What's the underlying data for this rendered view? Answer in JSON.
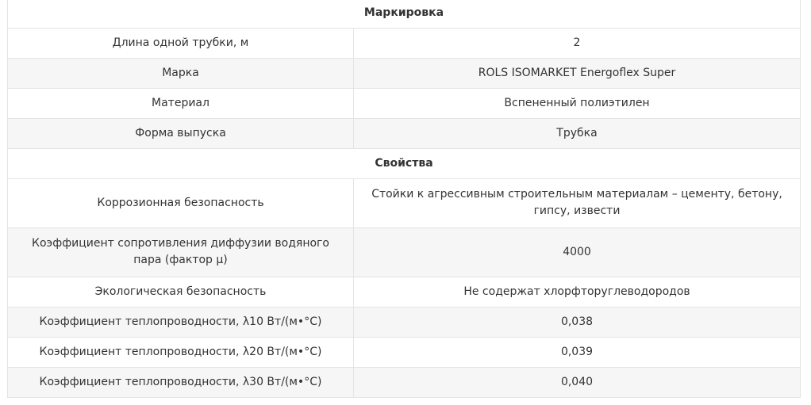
{
  "sections": [
    {
      "title": "Маркировка",
      "rows": [
        {
          "label": "Длина одной трубки, м",
          "value": "2"
        },
        {
          "label": "Марка",
          "value": "ROLS ISOMARKET Energoflex Super"
        },
        {
          "label": "Материал",
          "value": "Вспененный полиэтилен"
        },
        {
          "label": "Форма выпуска",
          "value": "Трубка"
        }
      ]
    },
    {
      "title": "Свойства",
      "rows": [
        {
          "label": "Коррозионная безопасность",
          "value": "Стойки к агрессивным строительным материалам – цементу, бетону, гипсу, извести"
        },
        {
          "label": "Коэффициент сопротивления диффузии водяного пара (фактор μ)",
          "value": "4000"
        },
        {
          "label": "Экологическая безопасность",
          "value": "Не содержат хлорфторуглеводородов"
        },
        {
          "label": "Коэффициент теплопроводности, λ10 Вт/(м•°С)",
          "value": "0,038"
        },
        {
          "label": "Коэффициент теплопроводности, λ20 Вт/(м•°С)",
          "value": "0,039"
        },
        {
          "label": "Коэффициент теплопроводности, λ30 Вт/(м•°С)",
          "value": "0,040"
        }
      ]
    }
  ]
}
